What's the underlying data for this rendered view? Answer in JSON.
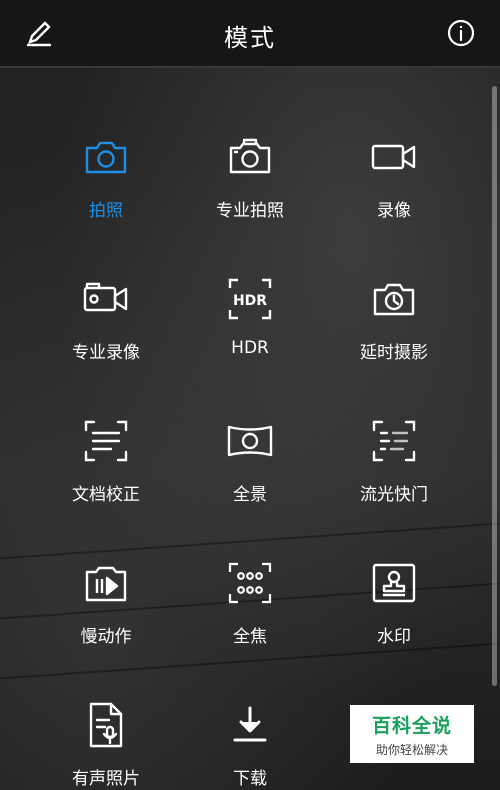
{
  "header": {
    "title": "模式",
    "edit_icon": "pencil-icon",
    "info_icon": "info-icon"
  },
  "modes": [
    {
      "label": "拍照",
      "icon": "camera-icon",
      "active": true
    },
    {
      "label": "专业拍照",
      "icon": "pro-camera-icon",
      "active": false
    },
    {
      "label": "录像",
      "icon": "video-icon",
      "active": false
    },
    {
      "label": "专业录像",
      "icon": "pro-video-icon",
      "active": false
    },
    {
      "label": "HDR",
      "icon": "hdr-icon",
      "active": false
    },
    {
      "label": "延时摄影",
      "icon": "timelapse-icon",
      "active": false
    },
    {
      "label": "文档校正",
      "icon": "document-scan-icon",
      "active": false
    },
    {
      "label": "全景",
      "icon": "panorama-icon",
      "active": false
    },
    {
      "label": "流光快门",
      "icon": "light-painting-icon",
      "active": false
    },
    {
      "label": "慢动作",
      "icon": "slow-motion-icon",
      "active": false
    },
    {
      "label": "全焦",
      "icon": "all-focus-icon",
      "active": false
    },
    {
      "label": "水印",
      "icon": "watermark-icon",
      "active": false
    },
    {
      "label": "有声照片",
      "icon": "audio-photo-icon",
      "active": false
    },
    {
      "label": "下载",
      "icon": "download-icon",
      "active": false
    }
  ],
  "watermark": {
    "main": "百科全说",
    "sub": "助你轻松解决"
  },
  "colors": {
    "accent": "#1e8fe6",
    "header_bg": "#161616",
    "watermark_green": "#18a05a"
  }
}
